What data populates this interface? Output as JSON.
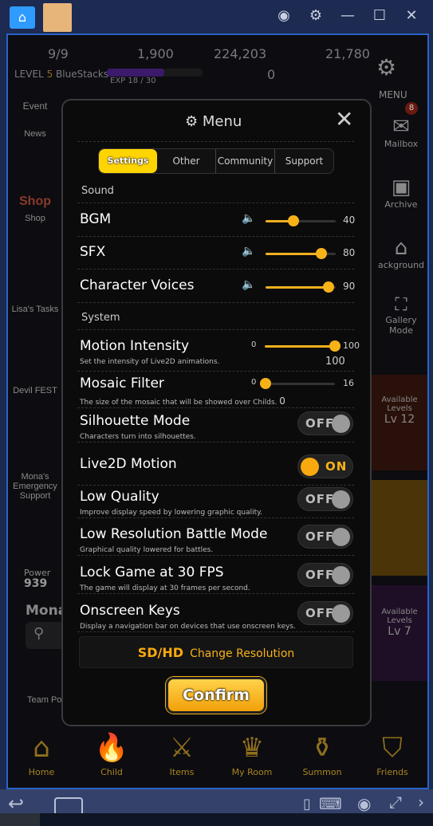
{
  "titlebar": {
    "icons": [
      "home-icon",
      "app-tab-icon",
      "account-icon",
      "gear-icon",
      "minimize-icon",
      "maximize-icon",
      "close-icon"
    ]
  },
  "hud": {
    "stamina": "9/9",
    "gems": "1,900",
    "gold": "224,203",
    "crystals": "21,780",
    "level_label": "LEVEL",
    "level": "5",
    "player": "BlueStacks",
    "exp": "EXP 18 / 30",
    "exp_progress": 0.6,
    "tickets": "0",
    "menu": "MENU",
    "mail_badge": "8"
  },
  "left": {
    "news": "News",
    "event": "Event",
    "shop": "Shop",
    "lisa": "Lisa's Tasks",
    "devil_fest": "Devil FEST",
    "mona": "Mona's Emergency Support",
    "power_label": "Power",
    "power": "939",
    "name": "Mona",
    "team": "Team Po"
  },
  "right": {
    "mailbox": "Mailbox",
    "archive": "Archive",
    "background": "ackground",
    "gallery": "Gallery Mode",
    "avail1": "Available Levels",
    "lv1": "Lv 12",
    "avail2": "Available Levels",
    "lv2": "Lv 7"
  },
  "menu": {
    "title": "Menu",
    "tabs": [
      "Settings",
      "Other",
      "Community",
      "Support"
    ],
    "active_tab": "Settings",
    "sound_label": "Sound",
    "sound": [
      {
        "label": "BGM",
        "value": 40
      },
      {
        "label": "SFX",
        "value": 80
      },
      {
        "label": "Character Voices",
        "value": 90
      }
    ],
    "system_label": "System",
    "motion": {
      "label": "Motion Intensity",
      "desc": "Set the intensity of Live2D animations.",
      "min": "0",
      "max": "100",
      "value": "100"
    },
    "mosaic": {
      "label": "Mosaic Filter",
      "desc": "The size of the mosaic that will be showed over Childs.",
      "min": "0",
      "max": "16",
      "value": "0"
    },
    "toggles": [
      {
        "label": "Silhouette Mode",
        "desc": "Characters turn into silhouettes.",
        "state": "OFF"
      },
      {
        "label": "Live2D Motion",
        "desc": "",
        "state": "ON"
      },
      {
        "label": "Low Quality",
        "desc": "Improve display speed by lowering graphic quality.",
        "state": "OFF"
      },
      {
        "label": "Low Resolution Battle Mode",
        "desc": "Graphical quality lowered for battles.",
        "state": "OFF"
      },
      {
        "label": "Lock Game at 30 FPS",
        "desc": "The game will display at 30 frames per second.",
        "state": "OFF"
      },
      {
        "label": "Onscreen Keys",
        "desc": "Display a navigation bar on devices that use onscreen keys.",
        "state": "OFF"
      }
    ],
    "resolution_badge": "SD/HD",
    "resolution_label": "Change Resolution",
    "confirm": "Confirm",
    "accent": "#f7b218"
  },
  "bottom_nav": [
    "Home",
    "Child",
    "Items",
    "My Room",
    "Summon",
    "Friends"
  ]
}
